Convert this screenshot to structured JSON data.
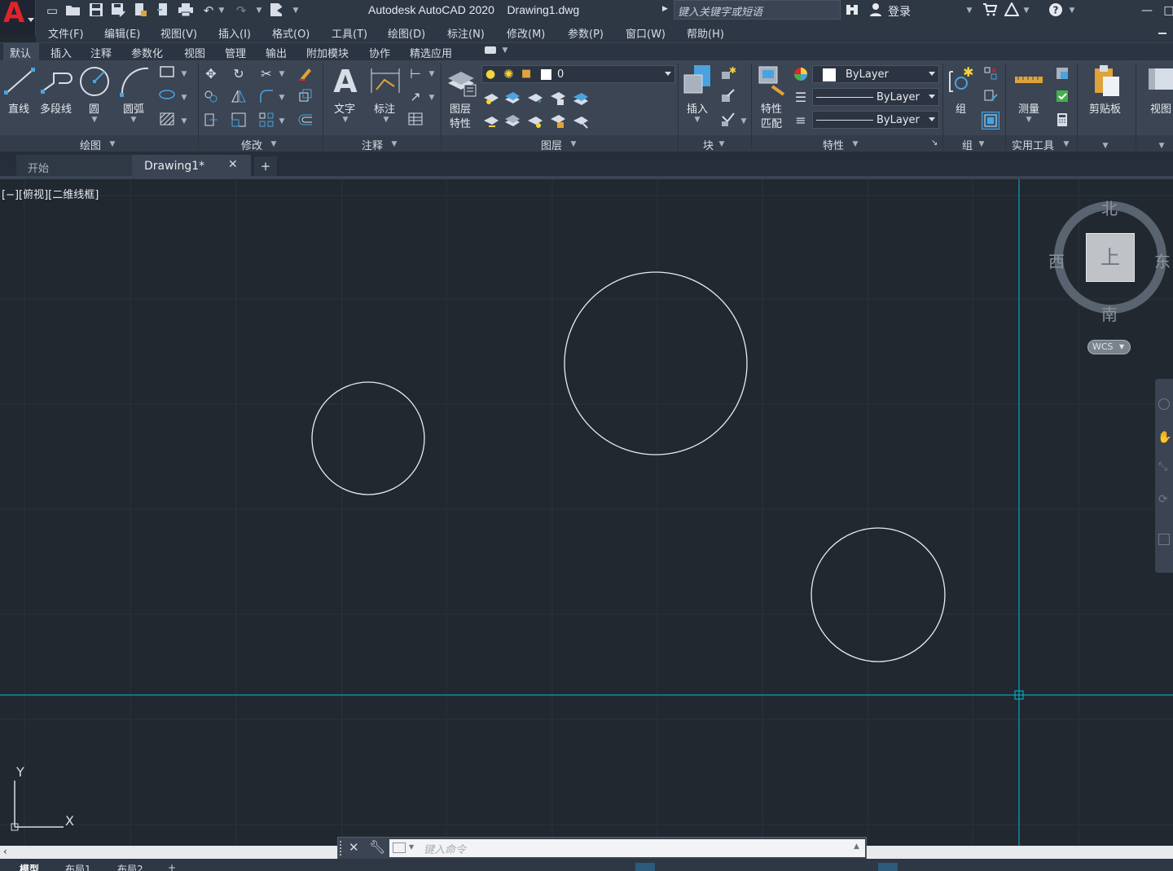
{
  "app": {
    "logo_letter": "A",
    "window_title": "Autodesk AutoCAD 2020    Drawing1.dwg",
    "search_placeholder": "键入关键字或短语",
    "login_label": "登录"
  },
  "menu": [
    "文件(F)",
    "编辑(E)",
    "视图(V)",
    "插入(I)",
    "格式(O)",
    "工具(T)",
    "绘图(D)",
    "标注(N)",
    "修改(M)",
    "参数(P)",
    "窗口(W)",
    "帮助(H)"
  ],
  "ribbon_tabs": [
    "默认",
    "插入",
    "注释",
    "参数化",
    "视图",
    "管理",
    "输出",
    "附加模块",
    "协作",
    "精选应用"
  ],
  "ribbon": {
    "draw": {
      "title": "绘图",
      "line": "直线",
      "polyline": "多段线",
      "circle": "圆",
      "arc": "圆弧"
    },
    "modify": {
      "title": "修改"
    },
    "annotation": {
      "title": "注释",
      "text": "文字",
      "dimension": "标注"
    },
    "layers": {
      "title": "图层",
      "layer_properties_1": "图层",
      "layer_properties_2": "特性",
      "current_layer": "0"
    },
    "block": {
      "title": "块",
      "insert": "插入"
    },
    "properties": {
      "title": "特性",
      "match_1": "特性",
      "match_2": "匹配",
      "color": "ByLayer",
      "linetype": "ByLayer",
      "lineweight": "ByLayer"
    },
    "groups": {
      "title": "组",
      "group": "组"
    },
    "utilities": {
      "title": "实用工具",
      "measure": "测量"
    },
    "clipboard": {
      "title": "剪贴板"
    },
    "view": {
      "title": "视图"
    }
  },
  "doc_tabs": {
    "start": "开始",
    "drawing": "Drawing1*",
    "close": "✕",
    "add": "+"
  },
  "viewport_label": "[−][俯视][二维线框]",
  "viewcube": {
    "north": "北",
    "south": "南",
    "east": "东",
    "west": "西",
    "top": "上",
    "wcs": "WCS"
  },
  "ucs": {
    "x": "X",
    "y": "Y"
  },
  "command_placeholder": "键入命令",
  "colors": {
    "canvas_bg": "#212830",
    "crosshair": "#00bcd4",
    "ribbon_bg": "#3b4553",
    "logo_red": "#e0232a"
  },
  "status_tabs": [
    "模型",
    "布局1",
    "布局2"
  ]
}
